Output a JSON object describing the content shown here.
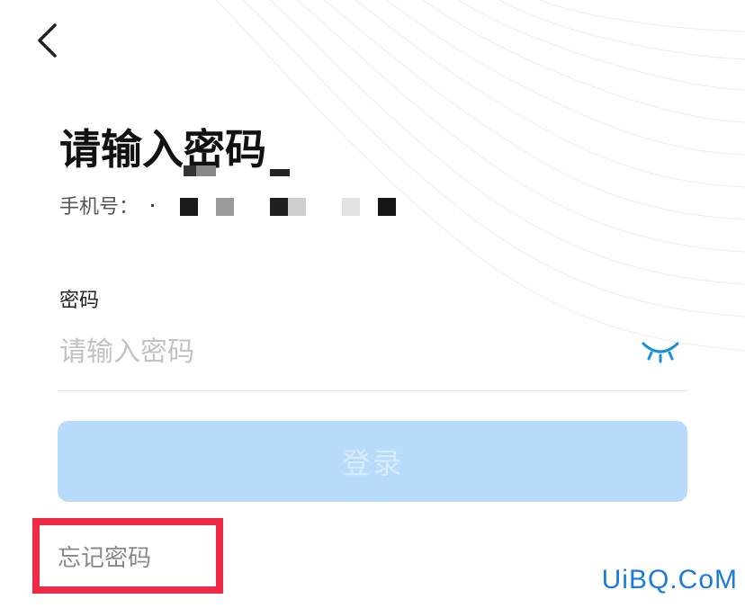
{
  "title": "请输入密码",
  "phone": {
    "label": "手机号："
  },
  "password_field": {
    "label": "密码",
    "placeholder": "请输入密码"
  },
  "login_button": {
    "label": "登录"
  },
  "forgot_password": {
    "label": "忘记密码"
  },
  "watermark": "UiBQ.CoM",
  "icons": {
    "back": "chevron-left-icon",
    "visibility": "eye-closed-icon"
  },
  "colors": {
    "accent": "#1a8fe0",
    "login_button_disabled": "#b8dbfb",
    "highlight_border": "#ee2a44",
    "watermark": "#1a7ae0"
  }
}
